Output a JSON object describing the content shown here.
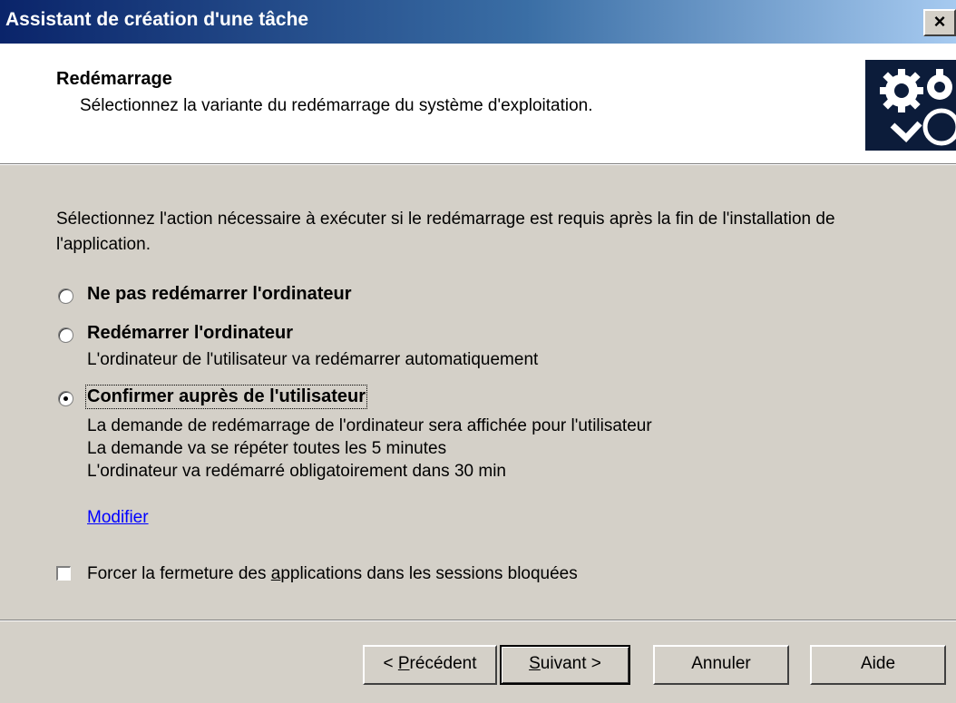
{
  "window": {
    "title": "Assistant de création d'une tâche",
    "close_glyph": "×"
  },
  "header": {
    "title": "Redémarrage",
    "subtitle": "Sélectionnez la variante du redémarrage du système d'exploitation.",
    "icon": "gears-icon"
  },
  "intro": "Sélectionnez l'action nécessaire à exécuter si le redémarrage est requis après la fin de l'installation de l'application.",
  "options": [
    {
      "label": "Ne pas redémarrer l'ordinateur",
      "selected": false,
      "desc": []
    },
    {
      "label": "Redémarrer l'ordinateur",
      "selected": false,
      "desc": [
        "L'ordinateur de l'utilisateur va redémarrer automatiquement"
      ]
    },
    {
      "label": "Confirmer auprès de l'utilisateur",
      "selected": true,
      "desc": [
        "La demande de redémarrage de l'ordinateur sera affichée pour l'utilisateur",
        "La demande va se répéter toutes les 5 minutes",
        "L'ordinateur va redémarré obligatoirement dans 30 min"
      ]
    }
  ],
  "modify_link": "Modifier",
  "force_close": {
    "label_pre": "Forcer la fermeture des ",
    "label_u": "a",
    "label_post": "pplications dans les sessions bloquées",
    "checked": false
  },
  "buttons": {
    "prev": {
      "pre": "< ",
      "u": "P",
      "post": "récédent"
    },
    "next": {
      "u": "S",
      "post": "uivant >"
    },
    "cancel": "Annuler",
    "help": "Aide"
  },
  "colors": {
    "titlebar_start": "#0a246a",
    "titlebar_end": "#a6caf0",
    "dialog_bg": "#d4d0c8",
    "link": "#0000ff"
  }
}
